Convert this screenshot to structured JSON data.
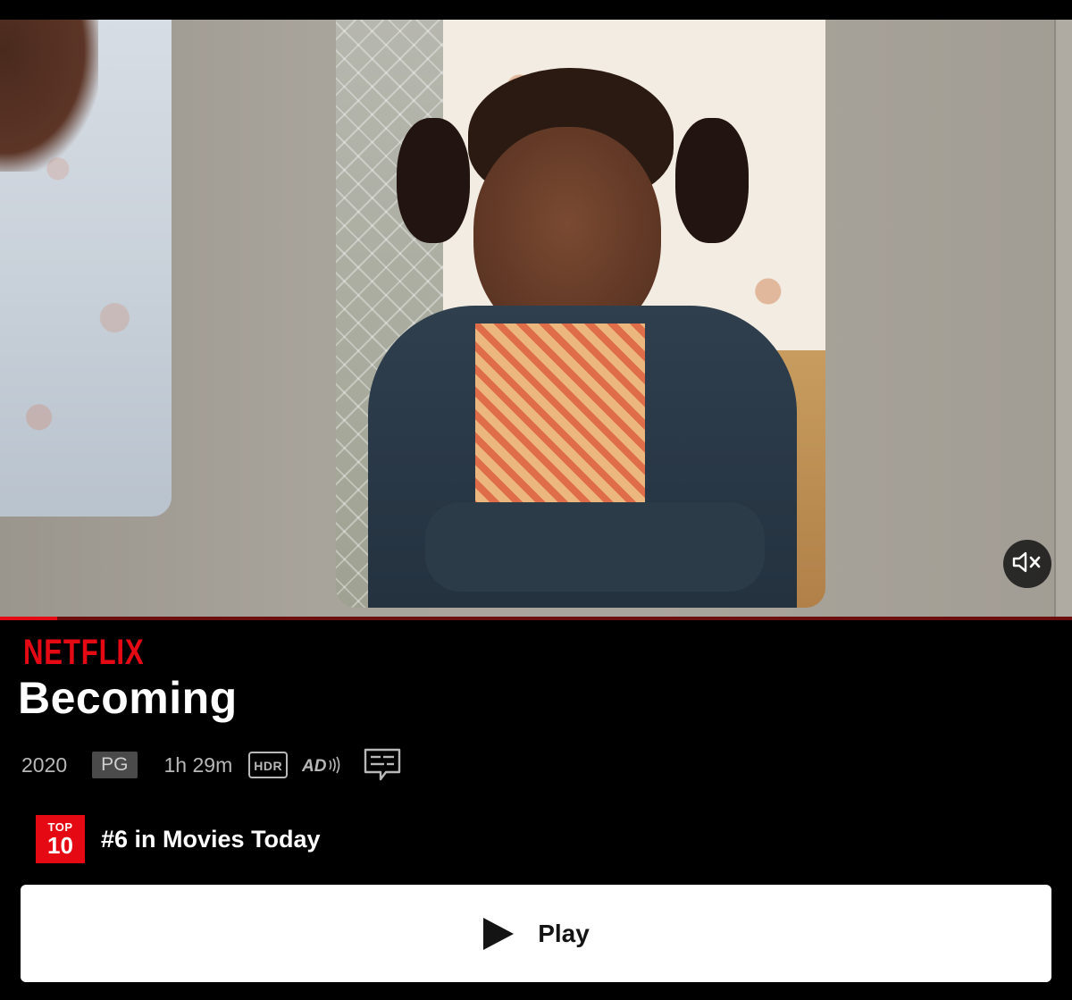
{
  "brand": "NETFLIX",
  "title": "Becoming",
  "meta": {
    "year": "2020",
    "rating": "PG",
    "runtime": "1h 29m",
    "hdr": "HDR",
    "audio_description_icon": "audio-description-icon",
    "subtitles_icon": "subtitles-icon"
  },
  "top10": {
    "badge_top": "TOP",
    "badge_num": "10",
    "text": "#6 in Movies Today"
  },
  "play_button": {
    "label": "Play",
    "icon": "play-icon"
  },
  "video": {
    "mute_icon": "volume-muted-icon",
    "progress": 0.053
  },
  "colors": {
    "brand": "#e50914",
    "background": "#000000",
    "button_bg": "#ffffff"
  }
}
